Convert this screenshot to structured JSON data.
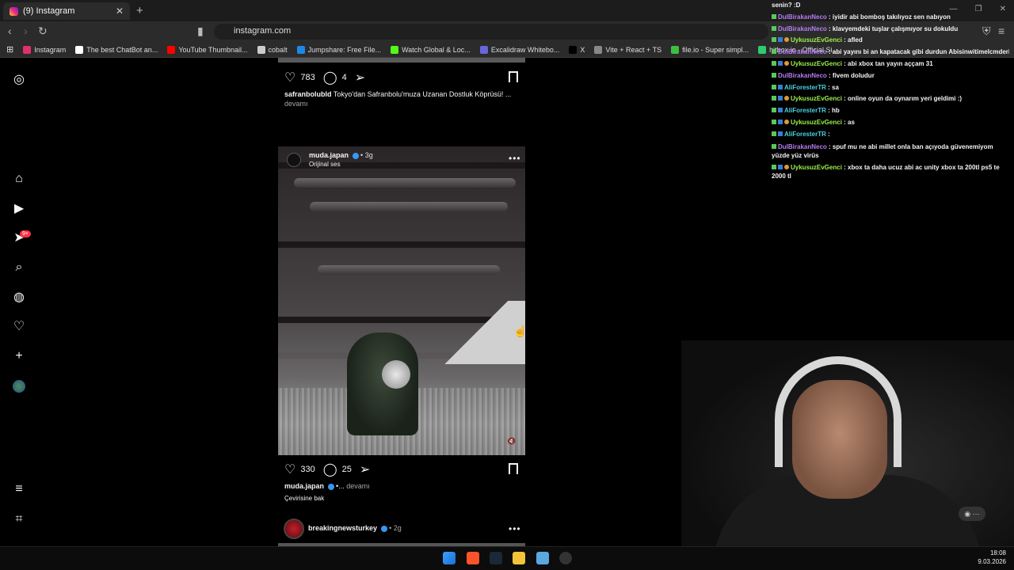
{
  "browser": {
    "tab_title": "(9) Instagram",
    "tab_close": "✕",
    "new_tab": "+",
    "url": "instagram.com",
    "bookmarks": [
      {
        "label": "Instagram",
        "color": "#e1306c"
      },
      {
        "label": "The best ChatBot an...",
        "color": "#ffffff"
      },
      {
        "label": "YouTube Thumbnail...",
        "color": "#ff0000"
      },
      {
        "label": "cobalt",
        "color": "#cccccc"
      },
      {
        "label": "Jumpshare: Free File...",
        "color": "#1e88e5"
      },
      {
        "label": "Watch Global & Loc...",
        "color": "#53fc18"
      },
      {
        "label": "Excalidraw Whitebo...",
        "color": "#6965db"
      },
      {
        "label": "X",
        "color": "#000000"
      },
      {
        "label": "Vite + React + TS",
        "color": "#888888"
      },
      {
        "label": "file.io - Super simpl...",
        "color": "#3fbf3f"
      },
      {
        "label": "hitbox.io - Official Si...",
        "color": "#2ecc71"
      }
    ]
  },
  "sidebar": {
    "notifications_badge": "9+"
  },
  "post1": {
    "likes": "783",
    "comments": "4",
    "username": "safranbolubld",
    "caption": "Tokyo'dan Safranbolu'muza Uzanan Dostluk Köprüsü! ...",
    "more": "devamı"
  },
  "post2": {
    "username": "muda.japan",
    "age": "• 3g",
    "audio": "Orijinal ses",
    "likes": "330",
    "comments": "25",
    "caption_user": "muda.japan",
    "caption_text": "•...",
    "more": "devamı",
    "translate": "Çevirisine bak"
  },
  "post3": {
    "username": "breakingnewsturkey",
    "age": "• 2g"
  },
  "chat": {
    "messages": [
      {
        "user": "",
        "text": "senin? :D",
        "color": "#ffffff",
        "badges": 0
      },
      {
        "user": "DulBirakanNeco",
        "text": ": iyidir abi bomboş takılıyoz sen nabıyon",
        "color": "#b57cf0",
        "badges": 1
      },
      {
        "user": "DulBirakanNeco",
        "text": ": klavyemdeki tuşlar çalışmıyor su dokuldu",
        "color": "#b57cf0",
        "badges": 1
      },
      {
        "user": "UykusuzEvGenci",
        "text": ": afled",
        "color": "#9cf04a",
        "badges": 3
      },
      {
        "user": "DulBirakanNeco",
        "text": ": abi yayını bi an kapatacak gibi durdun Abisinwitimelcmderi",
        "color": "#b57cf0",
        "badges": 1
      },
      {
        "user": "UykusuzEvGenci",
        "text": ": abi xbox tan yayın aççam 31",
        "color": "#9cf04a",
        "badges": 3
      },
      {
        "user": "DulBirakanNeco",
        "text": ": fivem doludur",
        "color": "#b57cf0",
        "badges": 1
      },
      {
        "user": "AliForesterTR",
        "text": ": sa",
        "color": "#4ad0e0",
        "badges": 2
      },
      {
        "user": "UykusuzEvGenci",
        "text": ": online oyun da oynarım yeri geldimi :)",
        "color": "#9cf04a",
        "badges": 3
      },
      {
        "user": "AliForesterTR",
        "text": ": hb",
        "color": "#4ad0e0",
        "badges": 2
      },
      {
        "user": "UykusuzEvGenci",
        "text": ": as",
        "color": "#9cf04a",
        "badges": 3
      },
      {
        "user": "AliForesterTR",
        "text": ":",
        "color": "#4ad0e0",
        "badges": 2
      },
      {
        "user": "DulBirakanNeco",
        "text": ": spuf mu ne abi millet onla ban açıyoda güvenemiyom yüzde yüz virüs",
        "color": "#b57cf0",
        "badges": 1,
        "wrap": true
      },
      {
        "user": "UykusuzEvGenci",
        "text": ": xbox ta daha ucuz abi ac unity xbox ta 200tl ps5 te 2000 tl",
        "color": "#9cf04a",
        "badges": 3,
        "wrap": true
      }
    ]
  },
  "taskbar": {
    "time": "18:08",
    "date": "9.03.2026"
  }
}
